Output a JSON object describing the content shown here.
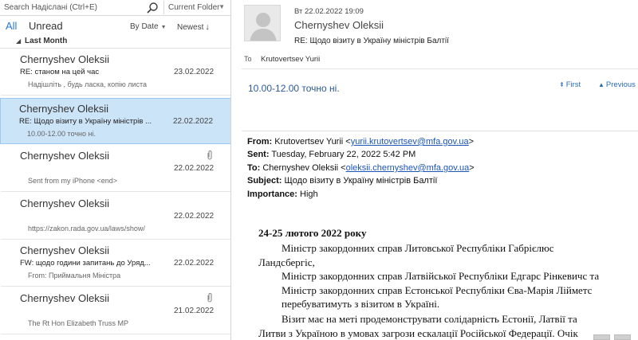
{
  "search": {
    "placeholder": "Search Надіслані (Ctrl+E)",
    "scope": "Current Folder"
  },
  "filters": {
    "all": "All",
    "unread": "Unread",
    "sort_by": "By Date",
    "sort_order": "Newest"
  },
  "group": {
    "label": "Last Month"
  },
  "messages": [
    {
      "sender": "Chernyshev Oleksii",
      "subject": "RE: станом на цей час",
      "date": "23.02.2022",
      "preview": "Надішліть , будь ласка, копію листа",
      "attachment": false,
      "selected": false
    },
    {
      "sender": "Chernyshev Oleksii",
      "subject": "RE: Щодо візиту в Україну міністрів ...",
      "date": "22.02.2022",
      "preview": "10.00-12.00 точно ні.",
      "attachment": false,
      "selected": true
    },
    {
      "sender": "Chernyshev Oleksii",
      "subject": "",
      "date": "22.02.2022",
      "preview": "Sent from my iPhone <end>",
      "attachment": true,
      "selected": false
    },
    {
      "sender": "Chernyshev Oleksii",
      "subject": "",
      "date": "22.02.2022",
      "preview": "https://zakon.rada.gov.ua/laws/show/",
      "attachment": false,
      "selected": false
    },
    {
      "sender": "Chernyshev Oleksii",
      "subject": "FW: щодо години запитань до Уряд...",
      "date": "22.02.2022",
      "preview": "From: Приймальня Міністра",
      "attachment": false,
      "selected": false
    },
    {
      "sender": "Chernyshev Oleksii",
      "subject": "",
      "date": "21.02.2022",
      "preview": "The Rt Hon Elizabeth Truss MP",
      "attachment": true,
      "selected": false
    }
  ],
  "reading": {
    "date": "Вт 22.02.2022 19:09",
    "sender": "Chernyshev Oleksii",
    "subject": "RE: Щодо візиту в Україну міністрів Балтії",
    "to_label": "To",
    "to": "Krutovertsev Yurii",
    "quick_text": "10.00-12.00 точно ні.",
    "nav_first": "First",
    "nav_previous": "Previous",
    "forward": {
      "from_label": "From:",
      "from_name": "Krutovertsev Yurii <",
      "from_email": "yurii.krutovertsev@mfa.gov.ua",
      "from_end": ">",
      "sent_label": "Sent:",
      "sent": "Tuesday, February 22, 2022 5:42 PM",
      "to_label": "To:",
      "to_name": "Chernyshev Oleksii <",
      "to_email": "oleksii.chernyshev@mfa.gov.ua",
      "to_end": ">",
      "subject_label": "Subject:",
      "subject": "Щодо візиту в Україну міністрів Балтії",
      "importance_label": "Importance:",
      "importance": "High"
    },
    "body_date": "24-25 лютого 2022 року",
    "body_lines": [
      "Міністр закордонних справ Литовської Республіки Габрієлюс",
      "Ландсбергіс,",
      "Міністр закордонних справ Латвійської Республіки Едгарс Рінкевичс та",
      "Міністр закордонних справ Естонської Республіки Єва-Марія Лійметс",
      "перебуватимуть з візитом в Україні.",
      "Візит має на меті продемонструвати солідарність Естонії, Латвії та",
      "Литви з Україною в умовах загрози ескалації Російської Федерації. Очік"
    ]
  },
  "colors": {
    "accent": "#2b79c9",
    "selection": "#cce4f7",
    "link": "#1a55b8"
  }
}
